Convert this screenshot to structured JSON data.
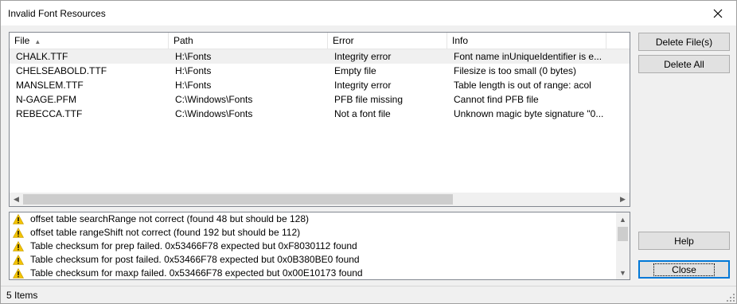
{
  "window": {
    "title": "Invalid Font Resources",
    "close_glyph": "✕"
  },
  "columns": [
    {
      "label": "File",
      "sort": "▲"
    },
    {
      "label": "Path"
    },
    {
      "label": "Error"
    },
    {
      "label": "Info"
    }
  ],
  "rows": [
    {
      "file": "CHALK.TTF",
      "path": "H:\\Fonts",
      "error": "Integrity error",
      "info": "Font name inUniqueIdentifier is e...",
      "selected": true
    },
    {
      "file": "CHELSEABOLD.TTF",
      "path": "H:\\Fonts",
      "error": "Empty file",
      "info": "Filesize is too small (0 bytes)"
    },
    {
      "file": "MANSLEM.TTF",
      "path": "H:\\Fonts",
      "error": "Integrity error",
      "info": "Table length is out of range: acol"
    },
    {
      "file": "N-GAGE.PFM",
      "path": "C:\\Windows\\Fonts",
      "error": "PFB file missing",
      "info": "Cannot find PFB file"
    },
    {
      "file": "REBECCA.TTF",
      "path": "C:\\Windows\\Fonts",
      "error": "Not a font file",
      "info": "Unknown magic byte signature \"0..."
    }
  ],
  "messages": [
    "offset table searchRange not correct (found 48 but should be 128)",
    "offset table rangeShift not correct (found 192 but should be 112)",
    "Table checksum for prep failed. 0x53466F78 expected but 0xF8030112 found",
    "Table checksum for post failed. 0x53466F78 expected but 0x0B380BE0 found",
    "Table checksum for maxp failed. 0x53466F78 expected but 0x00E10173 found"
  ],
  "buttons": {
    "delete_files": "Delete File(s)",
    "delete_all": "Delete All",
    "help": "Help",
    "close": "Close"
  },
  "status": {
    "items": "5 Items"
  },
  "colors": {
    "accent": "#0078d7",
    "warning": "#f2c200",
    "selected_row": "#f0f0f0"
  },
  "icons": {
    "warning": "warning-icon",
    "close": "close-icon"
  }
}
